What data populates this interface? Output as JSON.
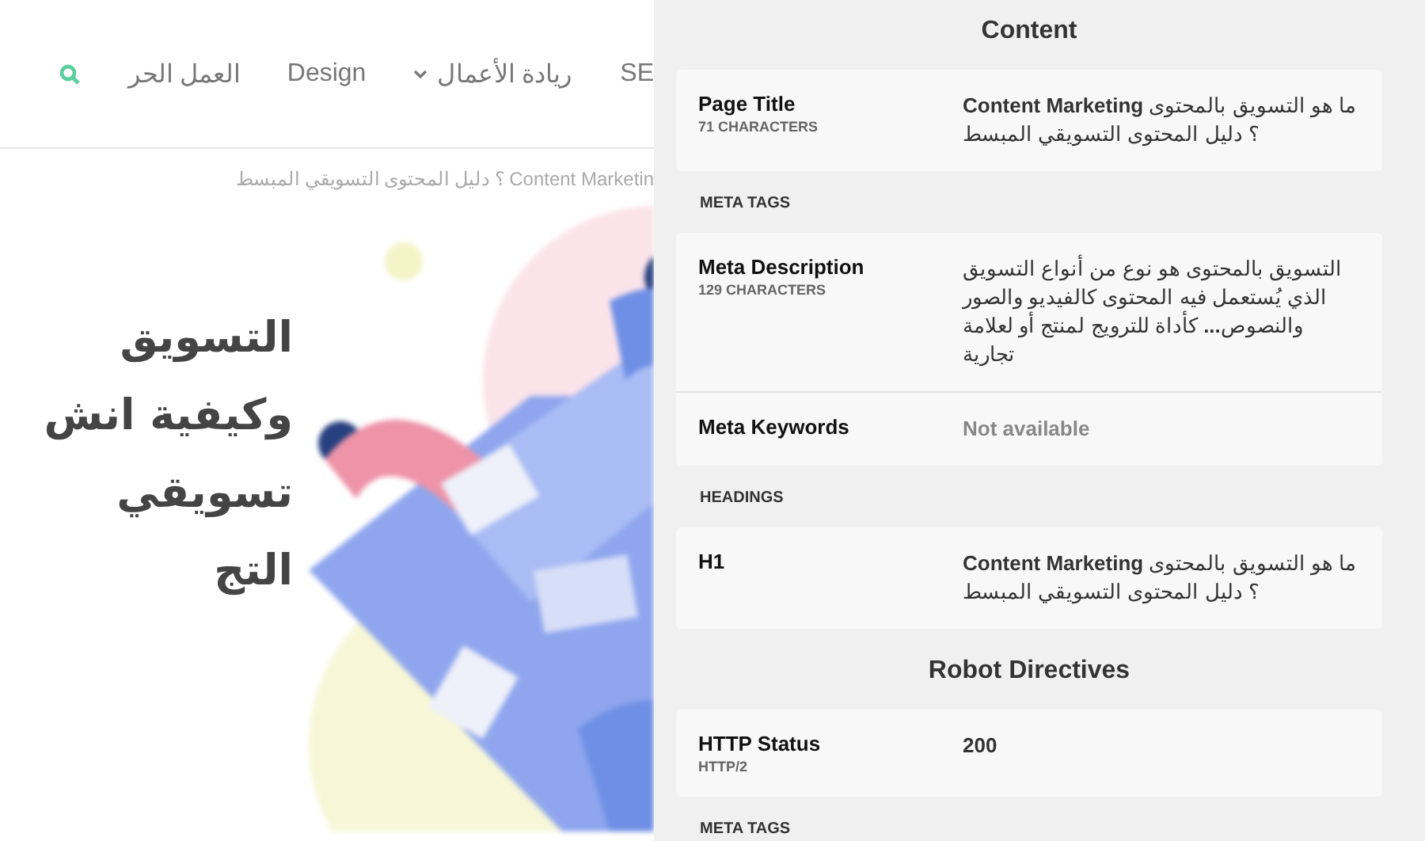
{
  "page": {
    "nav": [
      {
        "label": "SE",
        "kind": "link"
      },
      {
        "label": "ريادة الأعمال",
        "kind": "dropdown"
      },
      {
        "label": "Design",
        "kind": "link"
      },
      {
        "label": "العمل الحر",
        "kind": "link"
      }
    ],
    "breadcrumb": "Content Marketin ؟ دليل المحتوى التسويقي المبسط",
    "hero_lines": [
      "التسويق",
      "وكيفية انش",
      "تسويقي",
      "التج"
    ]
  },
  "panel": {
    "sections": [
      {
        "kind": "title",
        "text": "Content"
      },
      {
        "kind": "card",
        "rows": [
          {
            "label": "Page Title",
            "sublabel": "71 CHARACTERS",
            "value": "ما هو التسويق بالمحتوى **Content Marketing** ؟ دليل المحتوى التسويقي المبسط",
            "kind": "text"
          }
        ]
      },
      {
        "kind": "group",
        "text": "META TAGS"
      },
      {
        "kind": "card",
        "rows": [
          {
            "label": "Meta Description",
            "sublabel": "129 CHARACTERS",
            "value": "التسويق بالمحتوى هو نوع من أنواع التسويق الذي يُستعمل فيه المحتوى كالفيديو والصور والنصوص**...** كأداة للترويج لمنتج أو لعلامة تجارية",
            "kind": "text"
          },
          {
            "label": "Meta Keywords",
            "value": "Not available",
            "kind": "muted"
          }
        ]
      },
      {
        "kind": "group",
        "text": "HEADINGS"
      },
      {
        "kind": "card",
        "rows": [
          {
            "label": "H1",
            "value": "ما هو التسويق بالمحتوى **Content Marketing** ؟ دليل المحتوى التسويقي المبسط",
            "kind": "text"
          }
        ]
      },
      {
        "kind": "title",
        "text": "Robot Directives"
      },
      {
        "kind": "card",
        "rows": [
          {
            "label": "HTTP Status",
            "sublabel": "HTTP/2",
            "value": "200",
            "kind": "strong"
          }
        ]
      },
      {
        "kind": "group",
        "text": "META TAGS"
      }
    ]
  }
}
